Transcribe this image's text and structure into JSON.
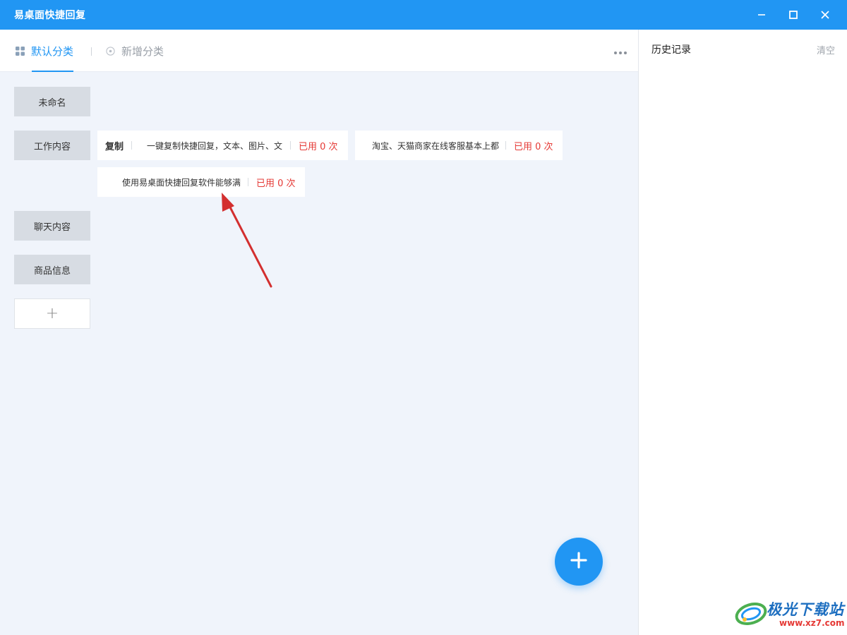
{
  "window": {
    "title": "易桌面快捷回复",
    "icons": {
      "minimize": "minimize-icon",
      "maximize": "maximize-icon",
      "close": "close-icon"
    }
  },
  "tabs": {
    "default_label": "默认分类",
    "add_label": "新增分类",
    "more_icon": "more-dots-icon"
  },
  "categories": [
    {
      "label": "未命名"
    },
    {
      "label": "工作内容"
    },
    {
      "label": "聊天内容"
    },
    {
      "label": "商品信息"
    },
    {
      "label": "+"
    }
  ],
  "cards": [
    {
      "title": "复制",
      "text": "一键复制快捷回复，文本、图片、文",
      "used": "已用 0 次"
    },
    {
      "title": "",
      "text": "淘宝、天猫商家在线客服基本上都",
      "used": "已用 0 次"
    },
    {
      "title": "",
      "text": "使用易桌面快捷回复软件能够满",
      "used": "已用 0 次"
    }
  ],
  "fab": {
    "icon": "plus-icon"
  },
  "history": {
    "title": "历史记录",
    "clear_label": "清空"
  },
  "watermark": {
    "name": "极光下载站",
    "url": "www.xz7.com"
  },
  "colors": {
    "accent": "#2196f3",
    "used_red": "#e53935",
    "arrow": "#d32f2f"
  }
}
